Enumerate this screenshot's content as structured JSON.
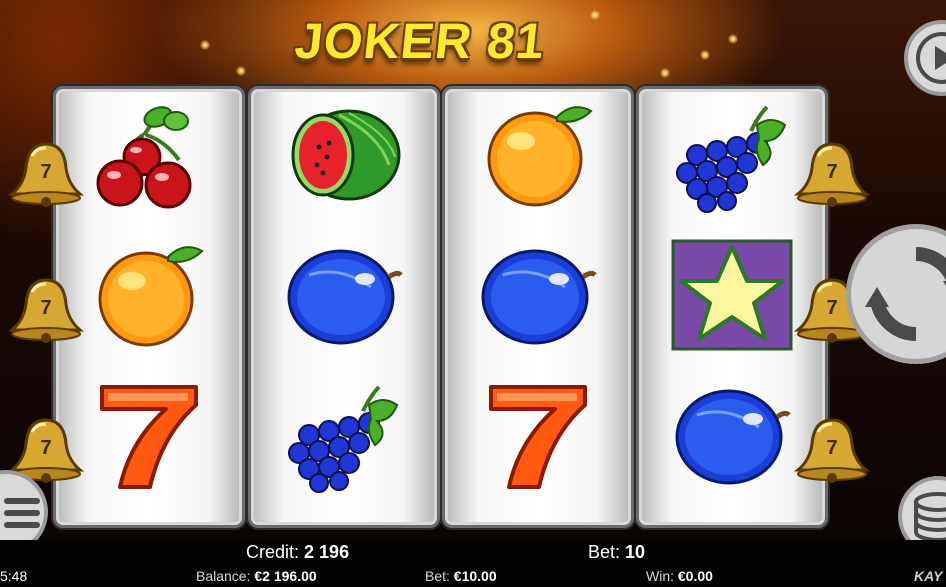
{
  "game": {
    "title": "JOKER 81"
  },
  "reels": [
    [
      "cherries",
      "orange",
      "seven"
    ],
    [
      "watermelon",
      "plum",
      "grapes"
    ],
    [
      "orange",
      "plum",
      "seven"
    ],
    [
      "grapes",
      "star",
      "plum"
    ]
  ],
  "bell_markers": {
    "label": "7"
  },
  "status": {
    "credit_label": "Credit:",
    "credit_value": "2 196",
    "bet_label": "Bet:",
    "bet_value": "10",
    "balance_label": "Balance:",
    "balance_value": "€2 196.00",
    "bet_money_label": "Bet:",
    "bet_money_value": "€10.00",
    "win_label": "Win:",
    "win_value": "€0.00",
    "clock": "5:48",
    "brand": "KAY"
  },
  "icons": {
    "play": "play-icon",
    "spin": "spin-icon",
    "menu": "menu-icon",
    "coins": "coin-stack-icon"
  },
  "colors": {
    "title_yellow": "#ffea2e",
    "button_gray": "#d9d9d9",
    "star_bg": "#7a4aa8"
  }
}
